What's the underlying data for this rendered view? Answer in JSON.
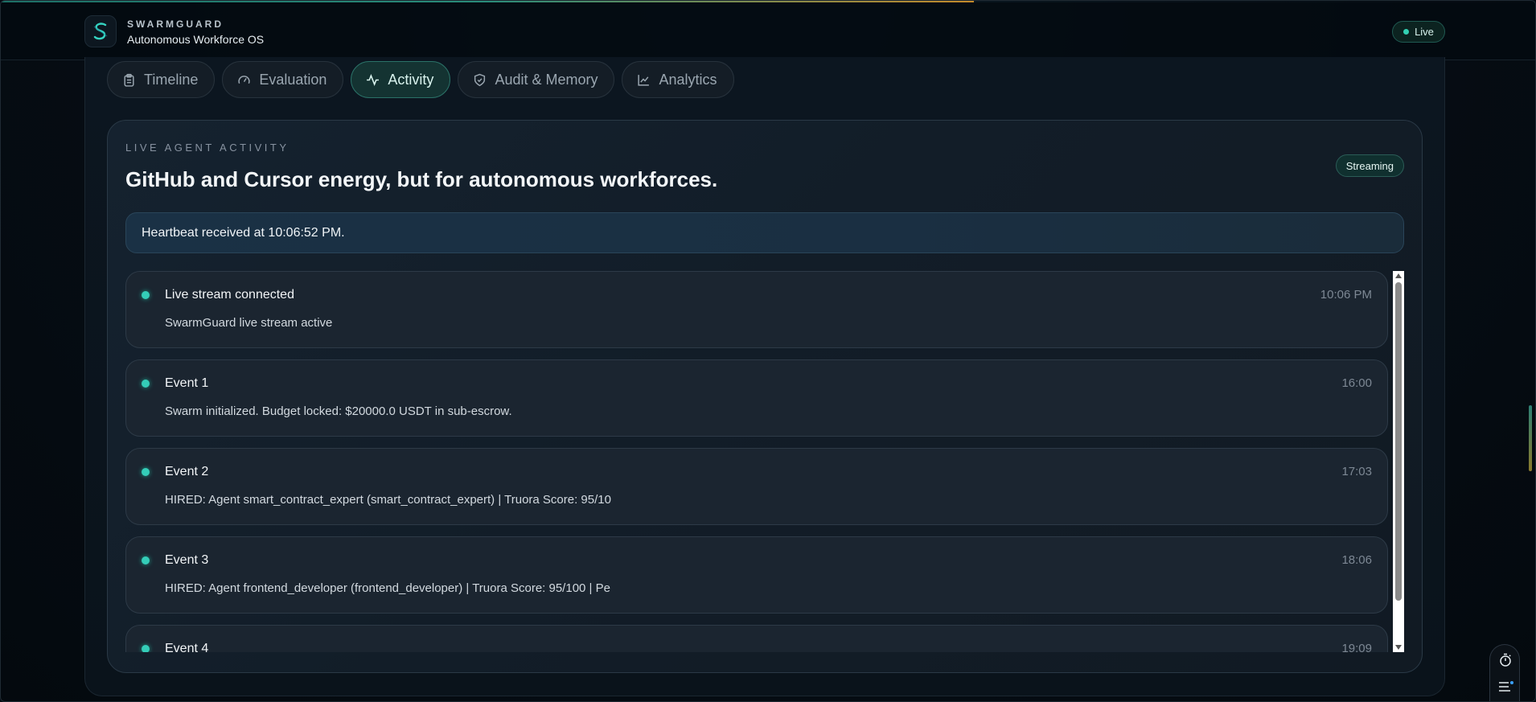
{
  "brand": {
    "name": "SWARMGUARD",
    "subtitle": "Autonomous Workforce OS",
    "logo_icon": "shield-s-logo",
    "accent": "#33d1b3"
  },
  "header": {
    "status_label": "Live"
  },
  "tabs": [
    {
      "label": "Timeline",
      "icon": "clipboard-icon",
      "active": false
    },
    {
      "label": "Evaluation",
      "icon": "gauge-icon",
      "active": false
    },
    {
      "label": "Activity",
      "icon": "activity-icon",
      "active": true
    },
    {
      "label": "Audit & Memory",
      "icon": "shield-icon",
      "active": false
    },
    {
      "label": "Analytics",
      "icon": "chart-line-icon",
      "active": false
    }
  ],
  "activity": {
    "eyebrow": "LIVE AGENT ACTIVITY",
    "headline": "GitHub and Cursor energy, but for autonomous workforces.",
    "stream_badge": "Streaming",
    "heartbeat": "Heartbeat received at 10:06:52 PM.",
    "events": [
      {
        "title": "Live stream connected",
        "time": "10:06 PM",
        "description": "SwarmGuard live stream active"
      },
      {
        "title": "Event 1",
        "time": "16:00",
        "description": "Swarm initialized. Budget locked: $20000.0 USDT in sub-escrow."
      },
      {
        "title": "Event 2",
        "time": "17:03",
        "description": "HIRED: Agent smart_contract_expert (smart_contract_expert) | Truora Score: 95/10"
      },
      {
        "title": "Event 3",
        "time": "18:06",
        "description": "HIRED: Agent frontend_developer (frontend_developer) | Truora Score: 95/100 | Pe"
      },
      {
        "title": "Event 4",
        "time": "19:09",
        "description": ""
      }
    ]
  },
  "dock": {
    "timer_icon": "stopwatch-icon",
    "menu_icon": "list-menu-icon"
  }
}
